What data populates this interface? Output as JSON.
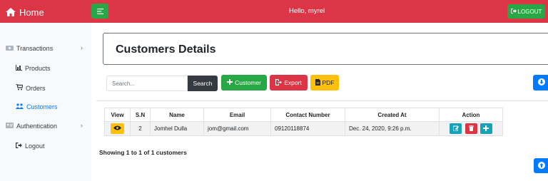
{
  "topbar": {
    "brand": "Home",
    "greeting": "Hello, myrel",
    "logout_label": "LOGOUT",
    "color": "#dc3545"
  },
  "sidebar": {
    "items": [
      {
        "label": "Transactions",
        "icon": "money-icon"
      },
      {
        "label": "Products",
        "icon": "bar-chart-icon"
      },
      {
        "label": "Orders",
        "icon": "cart-icon"
      },
      {
        "label": "Customers",
        "icon": "users-icon",
        "active": true
      },
      {
        "label": "Authentication",
        "icon": "id-card-icon"
      },
      {
        "label": "Logout",
        "icon": "sign-out-icon"
      }
    ]
  },
  "main": {
    "title": "Customers Details",
    "search": {
      "placeholder": "Search...",
      "value": "",
      "button_label": "Search"
    },
    "buttons": {
      "customer": "Customer",
      "export": "Export",
      "pdf": "PDF"
    },
    "table": {
      "headers": [
        "View",
        "S.N",
        "Name",
        "Email",
        "Contact Number",
        "Created At",
        "Action"
      ],
      "rows": [
        {
          "sn": "2",
          "name": "Jomhel Dulla",
          "email": "jom@gmail.com",
          "contact": "09120118874",
          "created_at": "Dec. 24, 2020, 9:26 p.m."
        }
      ]
    },
    "showing": "Showing 1 to 1 of 1 customers"
  },
  "colors": {
    "danger": "#dc3545",
    "success": "#28a745",
    "warning": "#ffc107",
    "info": "#17a2b8",
    "primary": "#007bff",
    "dark": "#343a40"
  }
}
